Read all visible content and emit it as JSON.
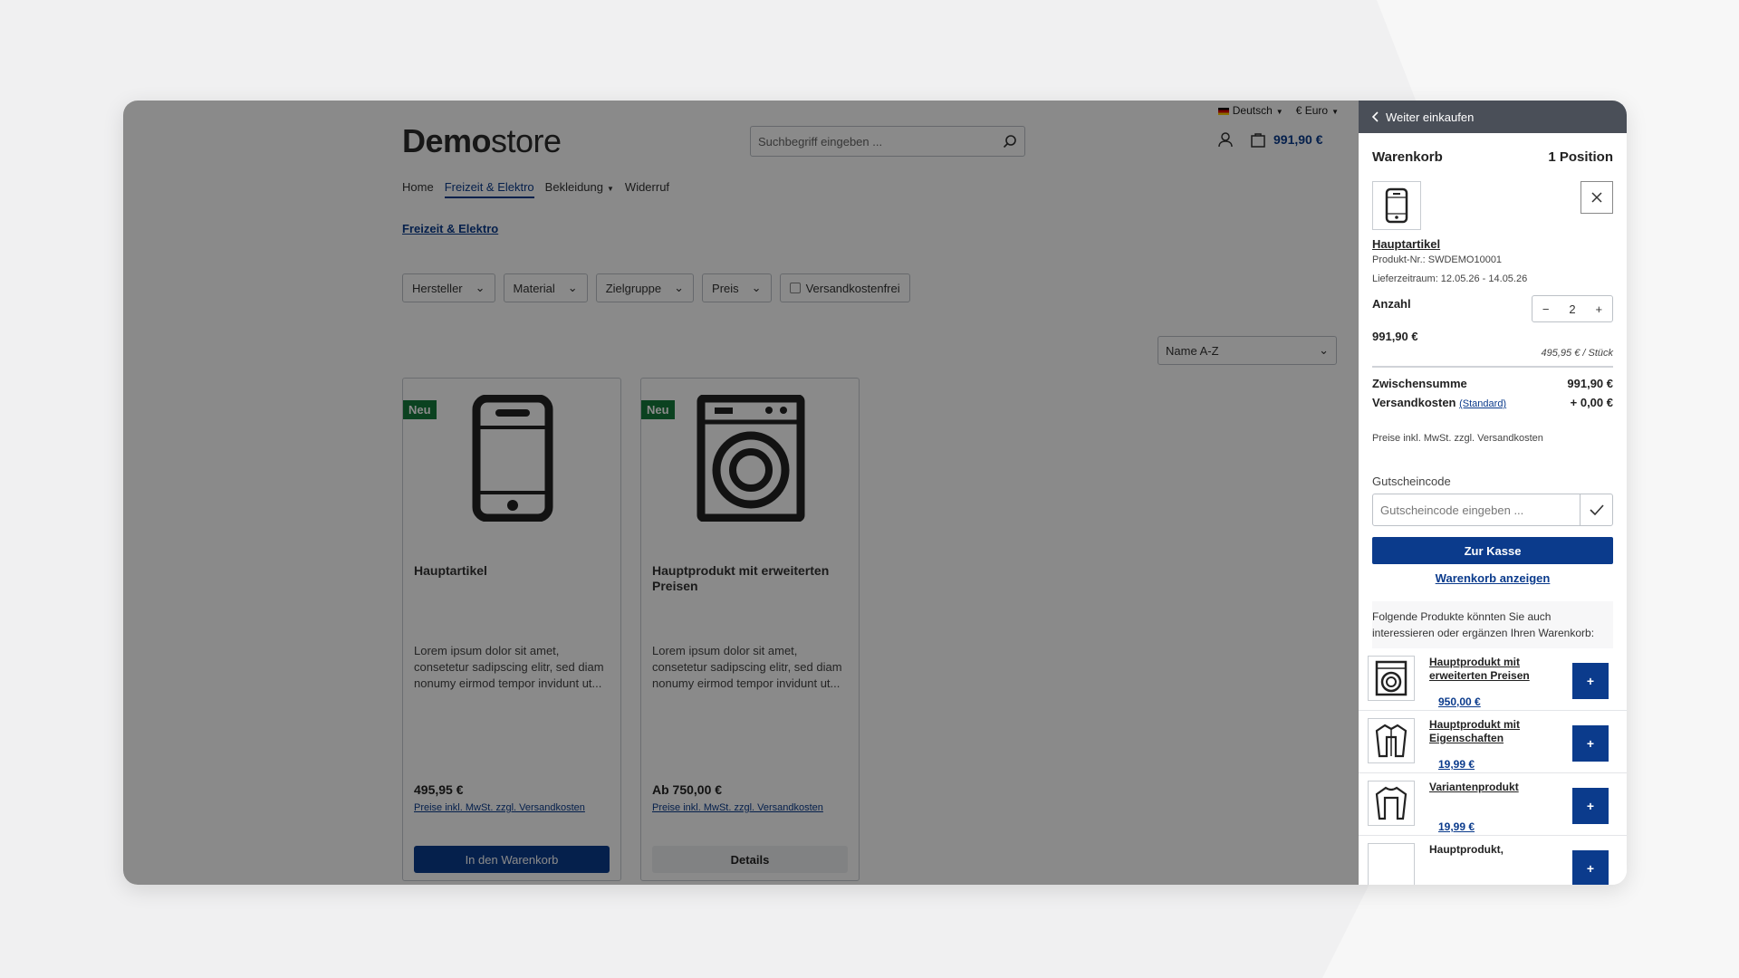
{
  "topbar": {
    "language": "Deutsch",
    "currency": "€ Euro"
  },
  "logo": {
    "bold": "Demo",
    "light": "store"
  },
  "search": {
    "placeholder": "Suchbegriff eingeben ..."
  },
  "header": {
    "cart_total": "991,90 €"
  },
  "nav": {
    "items": [
      "Home",
      "Freizeit & Elektro",
      "Bekleidung",
      "Widerruf"
    ]
  },
  "breadcrumb": "Freizeit & Elektro",
  "filters": [
    "Hersteller",
    "Material",
    "Zielgruppe",
    "Preis",
    "Versandkostenfrei"
  ],
  "sort": {
    "value": "Name A-Z"
  },
  "products": [
    {
      "badge": "Neu",
      "name": "Hauptartikel",
      "description": "Lorem ipsum dolor sit amet, consetetur sadipscing elitr, sed diam nonumy eirmod tempor invidunt ut...",
      "price": "495,95 €",
      "vat": "Preise inkl. MwSt. zzgl. Versandkosten",
      "button": "In den Warenkorb",
      "icon": "smartphone-icon"
    },
    {
      "badge": "Neu",
      "name": "Hauptprodukt mit erweiterten Preisen",
      "description": "Lorem ipsum dolor sit amet, consetetur sadipscing elitr, sed diam nonumy eirmod tempor invidunt ut...",
      "price": "Ab 750,00 €",
      "vat": "Preise inkl. MwSt. zzgl. Versandkosten",
      "button": "Details",
      "icon": "washing-machine-icon"
    }
  ],
  "drawer": {
    "back": "Weiter einkaufen",
    "title": "Warenkorb",
    "positions": "1 Position",
    "item": {
      "name": "Hauptartikel",
      "number": "Produkt-Nr.: SWDEMO10001",
      "delivery": "Lieferzeitraum: 12.05.26 - 14.05.26",
      "qty_label": "Anzahl",
      "qty": "2",
      "total": "991,90 €",
      "unit": "495,95 € / Stück"
    },
    "subtotal_label": "Zwischensumme",
    "subtotal": "991,90 €",
    "shipping_label": "Versandkosten",
    "shipping_method": "(Standard)",
    "shipping": "+ 0,00 €",
    "tax_note": "Preise inkl. MwSt. zzgl. Versandkosten",
    "coupon_label": "Gutscheincode",
    "coupon_placeholder": "Gutscheincode eingeben ...",
    "checkout": "Zur Kasse",
    "view_cart": "Warenkorb anzeigen",
    "reco_intro": "Folgende Produkte könnten Sie auch interessieren oder ergänzen Ihren Warenkorb:",
    "recommendations": [
      {
        "name": "Hauptprodukt mit erweiterten Preisen",
        "price": "950,00 €",
        "icon": "washing-machine-icon"
      },
      {
        "name": "Hauptprodukt mit Eigenschaften",
        "price": "19,99 €",
        "icon": "jacket-icon"
      },
      {
        "name": "Variantenprodukt",
        "price": "19,99 €",
        "icon": "sweater-icon"
      },
      {
        "name": "Hauptprodukt,",
        "price": "",
        "icon": "product-icon"
      }
    ],
    "add_label": "+"
  }
}
